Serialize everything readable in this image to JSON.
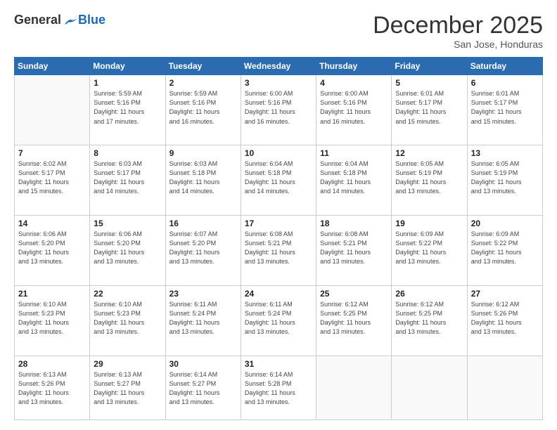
{
  "logo": {
    "general": "General",
    "blue": "Blue"
  },
  "header": {
    "month": "December 2025",
    "location": "San Jose, Honduras"
  },
  "weekdays": [
    "Sunday",
    "Monday",
    "Tuesday",
    "Wednesday",
    "Thursday",
    "Friday",
    "Saturday"
  ],
  "weeks": [
    [
      {
        "day": "",
        "info": ""
      },
      {
        "day": "1",
        "info": "Sunrise: 5:59 AM\nSunset: 5:16 PM\nDaylight: 11 hours\nand 17 minutes."
      },
      {
        "day": "2",
        "info": "Sunrise: 5:59 AM\nSunset: 5:16 PM\nDaylight: 11 hours\nand 16 minutes."
      },
      {
        "day": "3",
        "info": "Sunrise: 6:00 AM\nSunset: 5:16 PM\nDaylight: 11 hours\nand 16 minutes."
      },
      {
        "day": "4",
        "info": "Sunrise: 6:00 AM\nSunset: 5:16 PM\nDaylight: 11 hours\nand 16 minutes."
      },
      {
        "day": "5",
        "info": "Sunrise: 6:01 AM\nSunset: 5:17 PM\nDaylight: 11 hours\nand 15 minutes."
      },
      {
        "day": "6",
        "info": "Sunrise: 6:01 AM\nSunset: 5:17 PM\nDaylight: 11 hours\nand 15 minutes."
      }
    ],
    [
      {
        "day": "7",
        "info": "Sunrise: 6:02 AM\nSunset: 5:17 PM\nDaylight: 11 hours\nand 15 minutes."
      },
      {
        "day": "8",
        "info": "Sunrise: 6:03 AM\nSunset: 5:17 PM\nDaylight: 11 hours\nand 14 minutes."
      },
      {
        "day": "9",
        "info": "Sunrise: 6:03 AM\nSunset: 5:18 PM\nDaylight: 11 hours\nand 14 minutes."
      },
      {
        "day": "10",
        "info": "Sunrise: 6:04 AM\nSunset: 5:18 PM\nDaylight: 11 hours\nand 14 minutes."
      },
      {
        "day": "11",
        "info": "Sunrise: 6:04 AM\nSunset: 5:18 PM\nDaylight: 11 hours\nand 14 minutes."
      },
      {
        "day": "12",
        "info": "Sunrise: 6:05 AM\nSunset: 5:19 PM\nDaylight: 11 hours\nand 13 minutes."
      },
      {
        "day": "13",
        "info": "Sunrise: 6:05 AM\nSunset: 5:19 PM\nDaylight: 11 hours\nand 13 minutes."
      }
    ],
    [
      {
        "day": "14",
        "info": "Sunrise: 6:06 AM\nSunset: 5:20 PM\nDaylight: 11 hours\nand 13 minutes."
      },
      {
        "day": "15",
        "info": "Sunrise: 6:06 AM\nSunset: 5:20 PM\nDaylight: 11 hours\nand 13 minutes."
      },
      {
        "day": "16",
        "info": "Sunrise: 6:07 AM\nSunset: 5:20 PM\nDaylight: 11 hours\nand 13 minutes."
      },
      {
        "day": "17",
        "info": "Sunrise: 6:08 AM\nSunset: 5:21 PM\nDaylight: 11 hours\nand 13 minutes."
      },
      {
        "day": "18",
        "info": "Sunrise: 6:08 AM\nSunset: 5:21 PM\nDaylight: 11 hours\nand 13 minutes."
      },
      {
        "day": "19",
        "info": "Sunrise: 6:09 AM\nSunset: 5:22 PM\nDaylight: 11 hours\nand 13 minutes."
      },
      {
        "day": "20",
        "info": "Sunrise: 6:09 AM\nSunset: 5:22 PM\nDaylight: 11 hours\nand 13 minutes."
      }
    ],
    [
      {
        "day": "21",
        "info": "Sunrise: 6:10 AM\nSunset: 5:23 PM\nDaylight: 11 hours\nand 13 minutes."
      },
      {
        "day": "22",
        "info": "Sunrise: 6:10 AM\nSunset: 5:23 PM\nDaylight: 11 hours\nand 13 minutes."
      },
      {
        "day": "23",
        "info": "Sunrise: 6:11 AM\nSunset: 5:24 PM\nDaylight: 11 hours\nand 13 minutes."
      },
      {
        "day": "24",
        "info": "Sunrise: 6:11 AM\nSunset: 5:24 PM\nDaylight: 11 hours\nand 13 minutes."
      },
      {
        "day": "25",
        "info": "Sunrise: 6:12 AM\nSunset: 5:25 PM\nDaylight: 11 hours\nand 13 minutes."
      },
      {
        "day": "26",
        "info": "Sunrise: 6:12 AM\nSunset: 5:25 PM\nDaylight: 11 hours\nand 13 minutes."
      },
      {
        "day": "27",
        "info": "Sunrise: 6:12 AM\nSunset: 5:26 PM\nDaylight: 11 hours\nand 13 minutes."
      }
    ],
    [
      {
        "day": "28",
        "info": "Sunrise: 6:13 AM\nSunset: 5:26 PM\nDaylight: 11 hours\nand 13 minutes."
      },
      {
        "day": "29",
        "info": "Sunrise: 6:13 AM\nSunset: 5:27 PM\nDaylight: 11 hours\nand 13 minutes."
      },
      {
        "day": "30",
        "info": "Sunrise: 6:14 AM\nSunset: 5:27 PM\nDaylight: 11 hours\nand 13 minutes."
      },
      {
        "day": "31",
        "info": "Sunrise: 6:14 AM\nSunset: 5:28 PM\nDaylight: 11 hours\nand 13 minutes."
      },
      {
        "day": "",
        "info": ""
      },
      {
        "day": "",
        "info": ""
      },
      {
        "day": "",
        "info": ""
      }
    ]
  ]
}
